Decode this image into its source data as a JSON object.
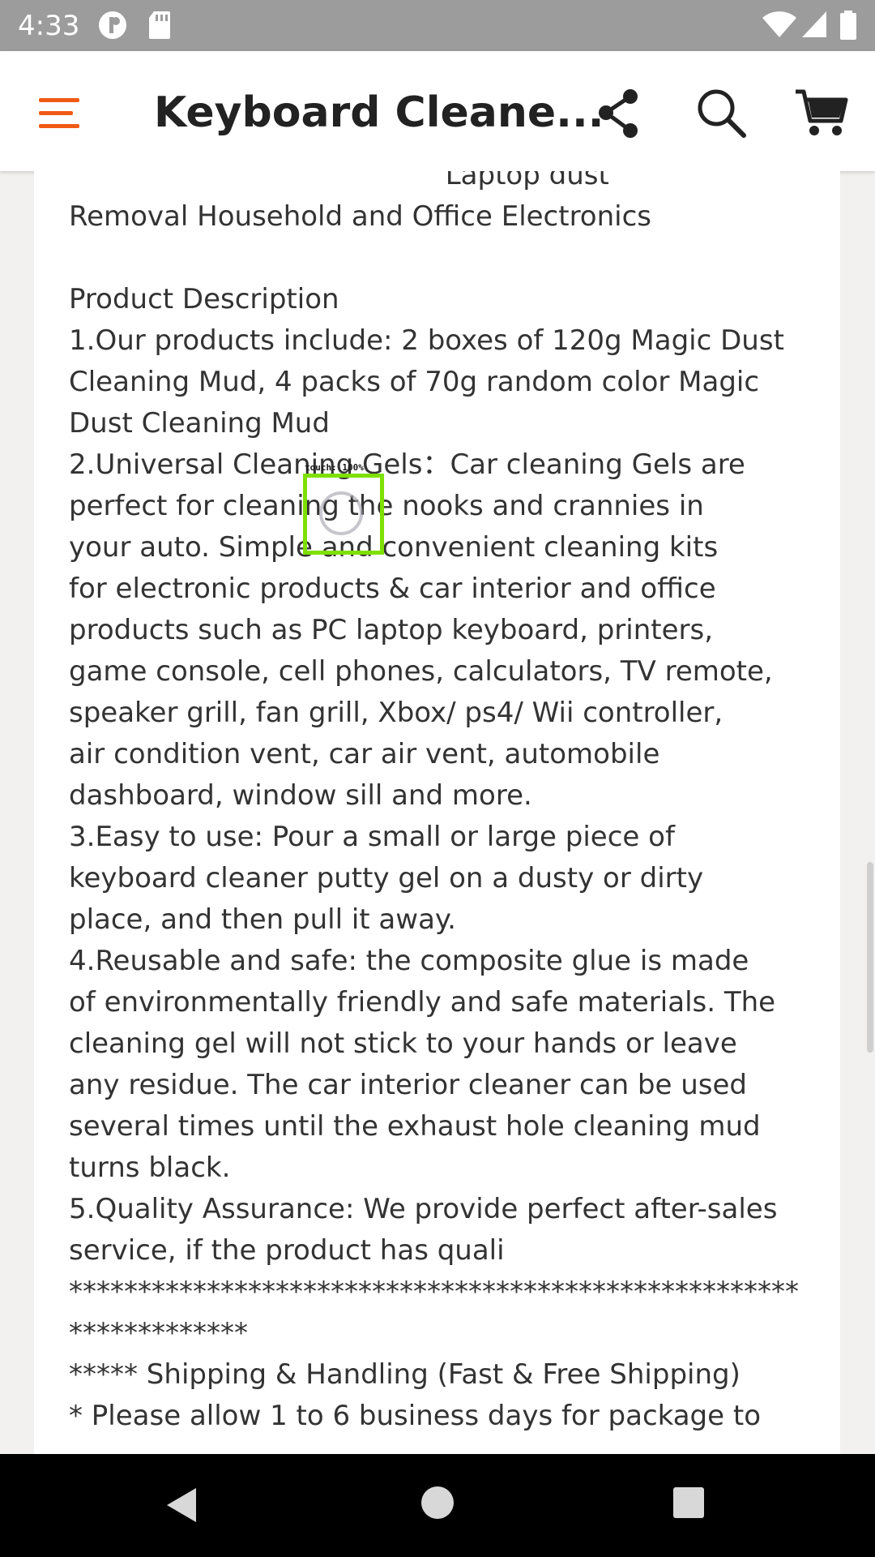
{
  "status_bar": {
    "time": "4:33",
    "icons": [
      "notification-app-icon",
      "sd-card-icon",
      "wifi-icon",
      "signal-icon",
      "battery-icon"
    ]
  },
  "app_bar": {
    "title": "Keyboard Cleane...",
    "accent_color": "#f05a14",
    "icons": [
      "menu-icon",
      "share-icon",
      "search-icon",
      "cart-icon"
    ]
  },
  "description": {
    "lines": [
      "                                           Laptop dust",
      "Removal Household and Office Electronics",
      "",
      "Product Description",
      "1.Our products include: 2 boxes of 120g Magic Dust",
      "Cleaning Mud, 4 packs of 70g random color Magic",
      "Dust Cleaning Mud",
      "2.Universal Cleaning Gels：Car cleaning Gels are",
      "perfect for cleaning the nooks and crannies in",
      "your auto. Simple and convenient cleaning kits",
      "for electronic products & car interior and office",
      "products such as PC laptop keyboard, printers,",
      "game console, cell phones, calculators, TV remote,",
      "speaker grill, fan grill, Xbox/ ps4/ Wii controller,",
      "air condition vent, car air vent, automobile",
      "dashboard, window sill and more.",
      "3.Easy to use: Pour a small or large piece of",
      "keyboard cleaner putty gel on a dusty or dirty",
      "place, and then pull it away.",
      "4.Reusable and safe: the composite glue is made",
      "of environmentally friendly and safe materials. The",
      "cleaning gel will not stick to your hands or leave",
      "any residue. The car interior cleaner can be used",
      "several times until the exhaust hole cleaning mud",
      "turns black.",
      "5.Quality Assurance: We provide perfect after-sales",
      "service, if the product has quali",
      "*****************************************************",
      "*************",
      "***** Shipping & Handling (Fast & Free Shipping)",
      "* Please allow 1 to 6 business days for package to"
    ]
  },
  "touch_indicator": {
    "label": "touch: 100%"
  },
  "nav_bar": {
    "icons": [
      "back-icon",
      "home-icon",
      "recents-icon"
    ]
  }
}
